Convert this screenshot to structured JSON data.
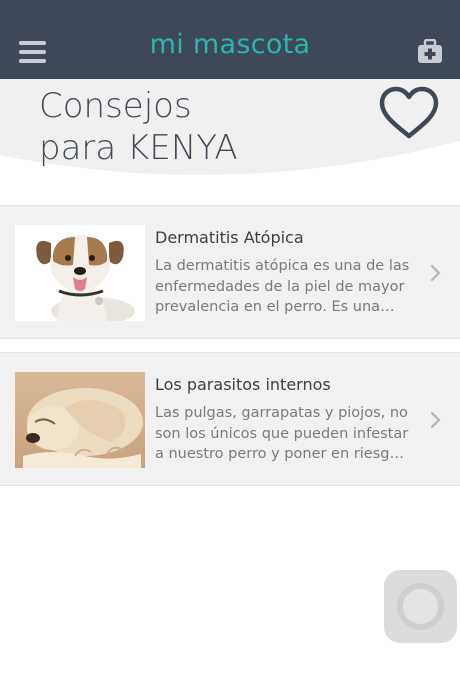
{
  "app": {
    "title": "mi mascota"
  },
  "header": {
    "title_line1": "Consejos",
    "title_line2": "para KENYA"
  },
  "advice": [
    {
      "title": "Dermatitis Atópica",
      "excerpt": "La dermatitis atópica es una de las enfermedades de la piel de mayor prevalencia en el perro. Es una alergia cutánea...",
      "image": "terrier-puppy-photo"
    },
    {
      "title": "Los parasitos internos",
      "excerpt": "Las pulgas, garrapatas y piojos, no son los únicos que pueden infestar a nuestro perro y poner en riesgo su salud...",
      "image": "sleeping-golden-puppy-photo"
    }
  ],
  "icons": {
    "menu": "hamburger-menu-icon",
    "medkit": "medkit-icon",
    "favorite": "heart-outline-icon",
    "chevron": "chevron-right-icon"
  },
  "colors": {
    "topbar": "#3f4859",
    "accent": "#26b8ad",
    "card_bg": "#f1f1f2"
  }
}
